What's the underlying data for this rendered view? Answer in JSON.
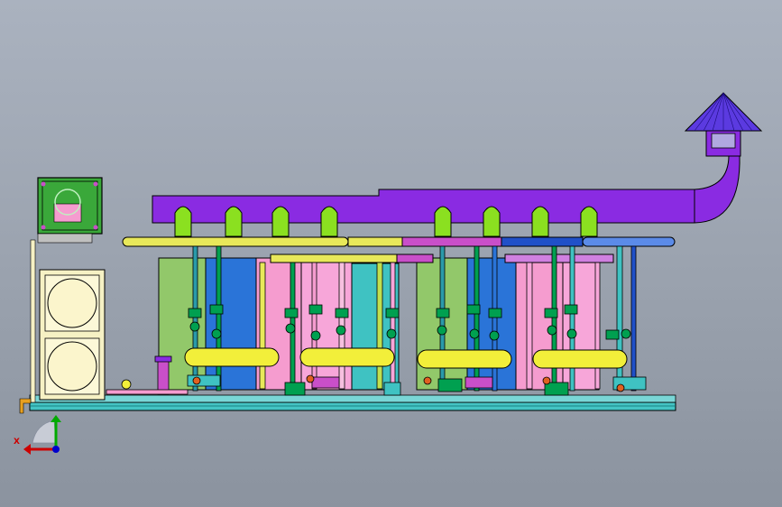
{
  "viewport": {
    "background_top": "#aab2bf",
    "background_bottom": "#8b939f"
  },
  "triad": {
    "x_label": "X",
    "x_color": "#cc0000",
    "y_color": "#00aa00",
    "z_color": "#0000cc"
  },
  "colors": {
    "exhaust_duct": "#8a2be2",
    "outline": "#000000",
    "header_yellow": "#e8e85a",
    "vessel_yellow": "#f2ef3a",
    "tank_green": "#92c86a",
    "tank_blue": "#2a74d8",
    "tank_pink": "#f59ccf",
    "valve_green": "#00a050",
    "skid_teal": "#3fc2c2",
    "water_tank_cream": "#f6f1c4",
    "control_panel_green": "#3aa83a"
  },
  "icons": [
    "coordinate-triad-icon",
    "valve-icon",
    "pump-icon",
    "rain-cap-icon"
  ]
}
